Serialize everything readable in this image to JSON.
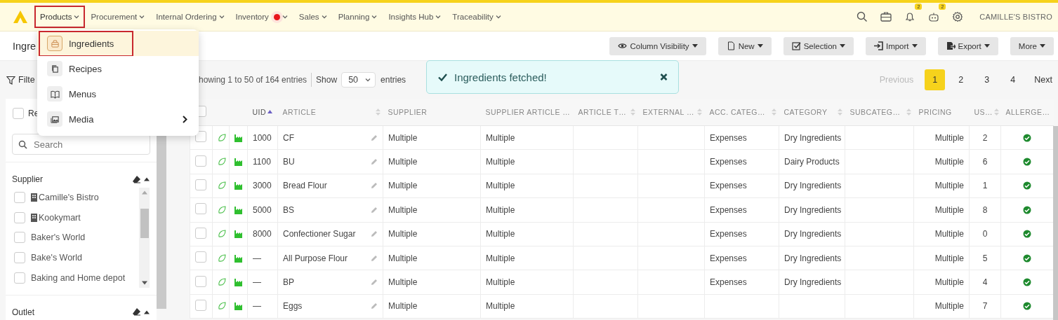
{
  "nav": {
    "items": [
      {
        "label": "Products",
        "selected": true,
        "dot": false
      },
      {
        "label": "Procurement",
        "selected": false,
        "dot": false
      },
      {
        "label": "Internal Ordering",
        "selected": false,
        "dot": false
      },
      {
        "label": "Inventory",
        "selected": false,
        "dot": true
      },
      {
        "label": "Sales",
        "selected": false,
        "dot": false
      },
      {
        "label": "Planning",
        "selected": false,
        "dot": false
      },
      {
        "label": "Insights Hub",
        "selected": false,
        "dot": false
      },
      {
        "label": "Traceability",
        "selected": false,
        "dot": false
      }
    ],
    "notification_badge": "2",
    "assistant_badge": "2",
    "account": "CAMILLE'S BISTRO"
  },
  "menu": {
    "items": [
      {
        "label": "Ingredients",
        "kind": "basket",
        "selected": true,
        "submenu": false
      },
      {
        "label": "Recipes",
        "kind": "copy",
        "selected": false,
        "submenu": false
      },
      {
        "label": "Menus",
        "kind": "book",
        "selected": false,
        "submenu": false
      },
      {
        "label": "Media",
        "kind": "image",
        "selected": false,
        "submenu": true
      }
    ]
  },
  "page_title": "Ingre",
  "toolbar": {
    "buttons": [
      {
        "label": "Column Visibility",
        "kind": "eye"
      },
      {
        "label": "New",
        "kind": "file"
      },
      {
        "label": "Selection",
        "kind": "check"
      },
      {
        "label": "Import",
        "kind": "import"
      },
      {
        "label": "Export",
        "kind": "export"
      },
      {
        "label": "More",
        "kind": "none"
      }
    ]
  },
  "filter_label": "Filte",
  "toast": {
    "message": "Ingredients fetched!"
  },
  "entries_info": "howing 1 to 50 of 164 entries",
  "page_length": {
    "label": "Show",
    "value": "50",
    "suffix": "entries"
  },
  "pagination": [
    {
      "label": "Previous",
      "selected": false,
      "disabled": true
    },
    {
      "label": "1",
      "selected": true,
      "disabled": false
    },
    {
      "label": "2",
      "selected": false,
      "disabled": false
    },
    {
      "label": "3",
      "selected": false,
      "disabled": false
    },
    {
      "label": "4",
      "selected": false,
      "disabled": false
    },
    {
      "label": "Next",
      "selected": false,
      "disabled": false
    }
  ],
  "sidebar": {
    "select_all": {
      "label": "Re",
      "checked": false
    },
    "search": {
      "placeholder": "Search"
    },
    "sections": [
      {
        "title": "Supplier",
        "items": [
          {
            "label": "Camille's Bistro",
            "kind": "outlet",
            "checked": false
          },
          {
            "label": "Kookymart",
            "kind": "outlet",
            "checked": false
          },
          {
            "label": "Baker's World",
            "kind": "supplier",
            "checked": false
          },
          {
            "label": "Bake's World",
            "kind": "supplier",
            "checked": false
          },
          {
            "label": "Baking and Home depot",
            "kind": "supplier",
            "checked": false
          }
        ]
      },
      {
        "title": "Outlet"
      }
    ]
  },
  "table": {
    "header_checked": false,
    "columns": [
      {
        "label": "UID",
        "sortable": true,
        "sorted": true
      },
      {
        "label": "ARTICLE",
        "sortable": true,
        "sorted": false
      },
      {
        "label": "SUPPLIER",
        "sortable": false,
        "sorted": false
      },
      {
        "label": "SUPPLIER ARTICLE …",
        "sortable": false,
        "sorted": false
      },
      {
        "label": "ARTICLE T…",
        "sortable": true,
        "sorted": false
      },
      {
        "label": "EXTERNAL …",
        "sortable": true,
        "sorted": false
      },
      {
        "label": "ACC. CATEG…",
        "sortable": true,
        "sorted": false
      },
      {
        "label": "CATEGORY",
        "sortable": true,
        "sorted": false
      },
      {
        "label": "SUBCATEG…",
        "sortable": true,
        "sorted": false
      },
      {
        "label": "PRICING",
        "sortable": false,
        "sorted": false
      },
      {
        "label": "US…",
        "sortable": true,
        "sorted": false
      },
      {
        "label": "ALLERGE…",
        "sortable": false,
        "sorted": false
      }
    ],
    "rows": [
      {
        "checked": false,
        "cells": [
          "1000",
          "CF",
          "Multiple",
          "Multiple",
          null,
          null,
          "Expenses",
          "Dry Ingredients",
          null,
          "Multiple",
          "2"
        ],
        "allergens_ok": true
      },
      {
        "checked": false,
        "cells": [
          "1100",
          "BU",
          "Multiple",
          "Multiple",
          null,
          null,
          "Expenses",
          "Dairy Products",
          null,
          "Multiple",
          "6"
        ],
        "allergens_ok": true
      },
      {
        "checked": false,
        "cells": [
          "3000",
          "Bread Flour",
          "Multiple",
          "Multiple",
          null,
          null,
          "Expenses",
          "Dry Ingredients",
          null,
          "Multiple",
          "1"
        ],
        "allergens_ok": true
      },
      {
        "checked": false,
        "cells": [
          "5000",
          "BS",
          "Multiple",
          "Multiple",
          null,
          null,
          "Expenses",
          "Dry Ingredients",
          null,
          "Multiple",
          "8"
        ],
        "allergens_ok": true
      },
      {
        "checked": false,
        "cells": [
          "8000",
          "Confectioner Sugar",
          "Multiple",
          "Multiple",
          null,
          null,
          "Expenses",
          "Dry Ingredients",
          null,
          "Multiple",
          "0"
        ],
        "allergens_ok": true
      },
      {
        "checked": false,
        "cells": [
          "—",
          "All Purpose Flour",
          "Multiple",
          "Multiple",
          null,
          null,
          "Expenses",
          "Dry Ingredients",
          null,
          "Multiple",
          "5"
        ],
        "allergens_ok": true
      },
      {
        "checked": false,
        "cells": [
          "—",
          "BP",
          "Multiple",
          "Multiple",
          null,
          null,
          "Expenses",
          "Dry Ingredients",
          null,
          "Multiple",
          "4"
        ],
        "allergens_ok": true
      },
      {
        "checked": false,
        "cells": [
          "—",
          "Eggs",
          "Multiple",
          "Multiple",
          null,
          null,
          null,
          null,
          null,
          "Multiple",
          "7"
        ],
        "allergens_ok": true
      }
    ]
  }
}
